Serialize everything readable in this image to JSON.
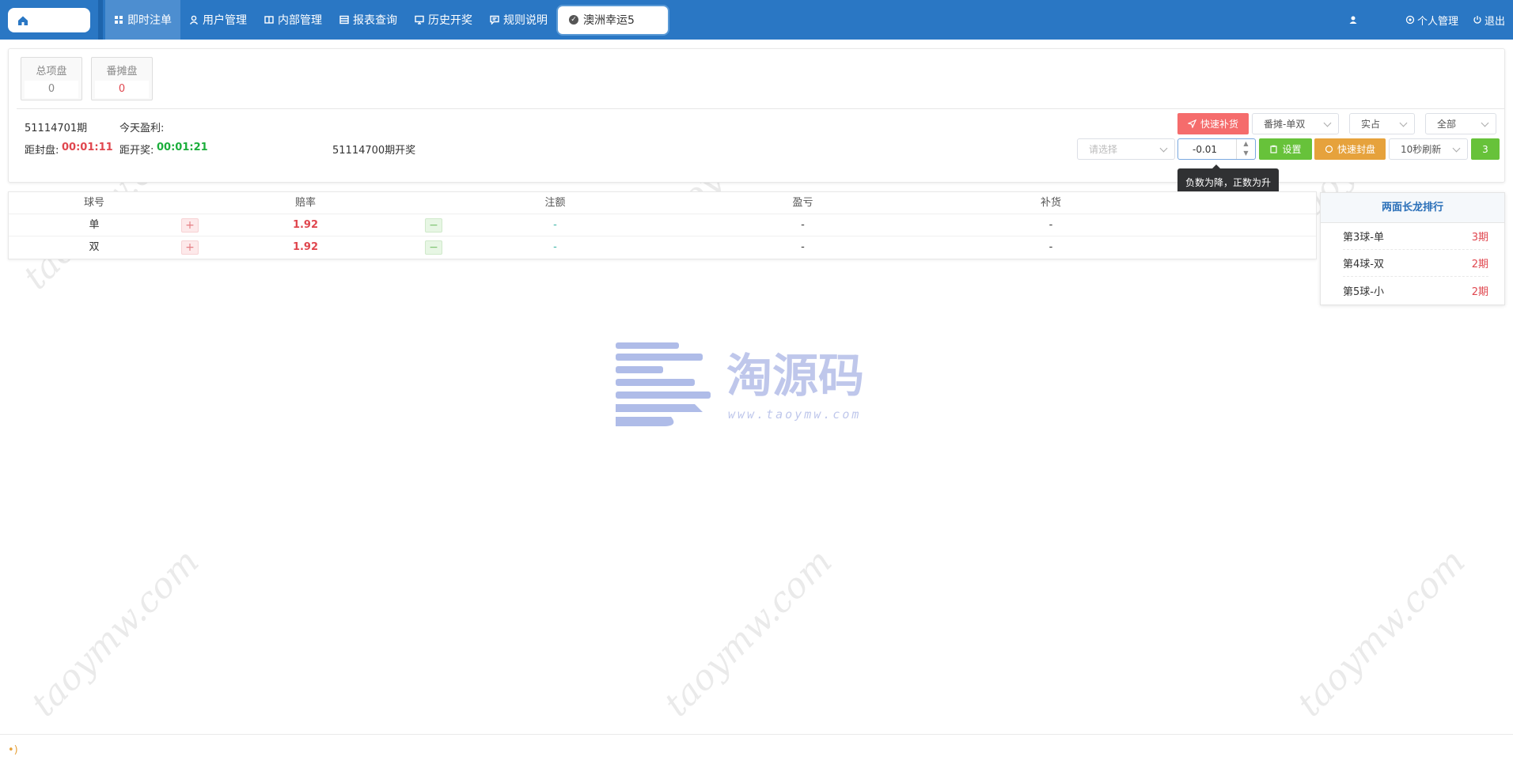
{
  "nav": {
    "items": [
      {
        "label": "即时注单",
        "icon": "grid-icon",
        "active": true
      },
      {
        "label": "用户管理",
        "icon": "user-icon"
      },
      {
        "label": "内部管理",
        "icon": "book-icon"
      },
      {
        "label": "报表查询",
        "icon": "table-icon"
      },
      {
        "label": "历史开奖",
        "icon": "monitor-icon"
      },
      {
        "label": "规则说明",
        "icon": "message-icon"
      }
    ],
    "game_tab": "澳洲幸运5",
    "personal": "个人管理",
    "logout": "退出"
  },
  "stats": [
    {
      "label": "总项盘",
      "value": "0",
      "color": "#888"
    },
    {
      "label": "番摊盘",
      "value": "0",
      "color": "#e0474f"
    }
  ],
  "info": {
    "period": "51114701期",
    "profit_label": "今天盈利:",
    "close_label": "距封盘:",
    "close_time": "00:01:11",
    "open_label": "距开奖:",
    "open_time": "00:01:21",
    "last_draw": "51114700期开奖"
  },
  "controls": {
    "quick_replenish": "快速补货",
    "play_select": "番摊-单双",
    "mode_select": "实占",
    "scope_select": "全部",
    "placeholder_select": "请选择",
    "step_value": "-0.01",
    "set_button": "设置",
    "quick_close": "快速封盘",
    "refresh_select": "10秒刷新",
    "refresh_count": "3",
    "tooltip": "负数为降，正数为升"
  },
  "table": {
    "headers": [
      "球号",
      "赔率",
      "注额",
      "盈亏",
      "补货"
    ],
    "rows": [
      {
        "name": "单",
        "odds": "1.92",
        "stake": "-",
        "profit": "-",
        "replenish": "-"
      },
      {
        "name": "双",
        "odds": "1.92",
        "stake": "-",
        "profit": "-",
        "replenish": "-"
      }
    ]
  },
  "ranking": {
    "title": "两面长龙排行",
    "items": [
      {
        "name": "第3球-单",
        "periods": "3期"
      },
      {
        "name": "第4球-双",
        "periods": "2期"
      },
      {
        "name": "第5球-小",
        "periods": "2期"
      }
    ]
  },
  "watermark": {
    "text": "taoymw.com",
    "logo_cn": "淘源码",
    "logo_url": "www.taoymw.com"
  }
}
